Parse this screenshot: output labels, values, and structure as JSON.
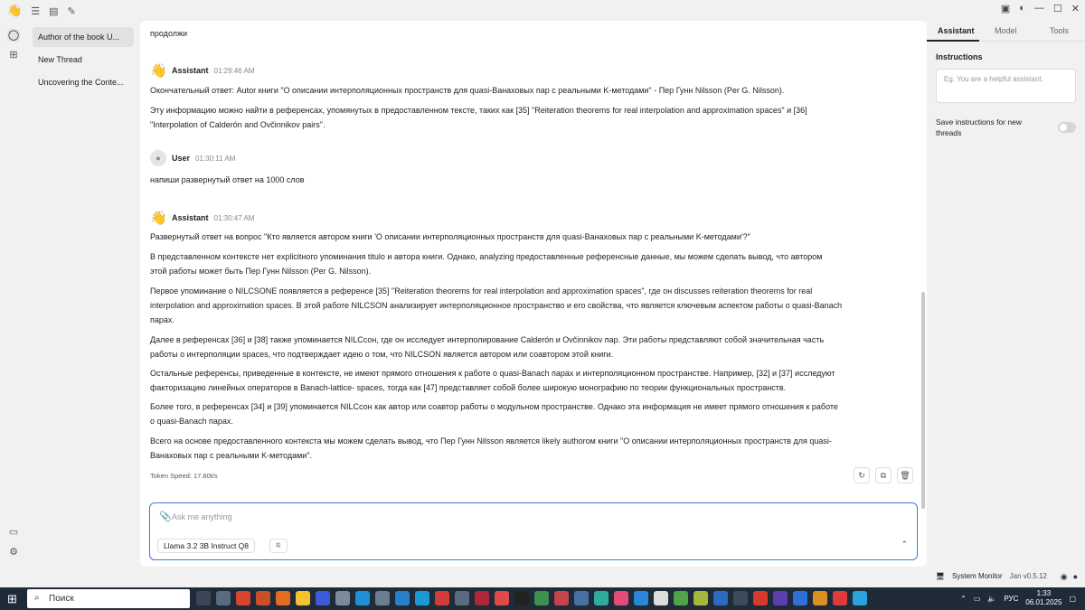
{
  "app": {
    "version": "Jan v0.5.12"
  },
  "threads": [
    {
      "title": "Author of the book U..."
    },
    {
      "title": "New Thread"
    },
    {
      "title": "Uncovering the Conte..."
    }
  ],
  "messages": {
    "prev_user_text": "продолжи",
    "assistant1": {
      "name": "Assistant",
      "time": "01:29:46 AM",
      "lines": [
        "Окончательный ответ: Autor книги \"О описании интерполяционных пространств для quasi-Ванаховых пар с реальными K-методами\" - Пер Гунн Nilsson (Per G. Nilsson).",
        "Эту информацию можно найти в референсах, упомянутых в предоставленном тексте, таких как [35] \"Reiteration theorems for real interpolation and approximation spaces\" и [36]",
        "\"Interpolation of Calderón and Ovčinnikov pairs\"."
      ]
    },
    "user": {
      "name": "User",
      "time": "01:30:11 AM",
      "text": "напиши развернутый ответ на 1000 слов"
    },
    "assistant2": {
      "name": "Assistant",
      "time": "01:30:47 AM",
      "lines": [
        "Развернутый ответ на вопрос \"Кто является автором книги 'О описании интерполяционных пространств для quasi-Ванаховых пар с реальными K-методами'?\"",
        "В представленном контексте нет explicitного упоминания titulo и автора книги. Однако, analyzing предоставленные референсные данные, мы можем сделать вывод, что автором",
        "этой работы может быть Пер Гунн Nilsson (Per G. Nilsson).",
        "Первое упоминание о NILCSONE появляется в референсе [35] \"Reiteration theorems for real interpolation and approximation spaces\", где он discusses reiteration theorems for real",
        "interpolation and approximation spaces. В этой работе NILCSON анализирует интерполяционное пространство и его свойства, что является ключевым аспектом работы о quasi-Banach",
        "парах.",
        "Далее в референсах [36] и [38] также упоминается NILCсон, где он исследует интерполирование Calderón и Ovčinnikov пар. Эти работы представляют собой значительная часть",
        "работы о интерполяции spaces, что подтверждает идею о том, что NILCSON является автором или соавтором этой книги.",
        "Остальные референсы, приведенные в контексте, не имеют прямого отношения к работе о quasi-Banach парах и интерполяционном пространстве. Например, [32] и [37] исследуют",
        "факторизацию линейных операторов в Banach-lattice- spaces, тогда как [47] представляет собой более широкую монографию по теории функциональных пространств.",
        "Более того, в референсах [34] и [39] упоминается NILCсон как автор или соавтор работы о модульном пространстве. Однако эта информация не имеет прямого отношения к работе",
        "о quasi-Banach парах.",
        "Всего на основе предоставленного контекста мы можем сделать вывод, что Пер Гунн Nilsson является likely authorом книги \"О описании интерполяционных пространств для quasi-",
        "Ванаховых пар с реальными K-методами\"."
      ],
      "token_speed": "Token Speed: 17.60t/s"
    }
  },
  "composer": {
    "placeholder": "Ask me anything",
    "model": "Llama 3.2 3B Instruct Q8"
  },
  "right_panel": {
    "tabs": [
      "Assistant",
      "Model",
      "Tools"
    ],
    "instructions_title": "Instructions",
    "instructions_placeholder": "Eg. You are a helpful assistant.",
    "save_label": "Save instructions for new threads",
    "save_toggle_on": false
  },
  "status_bar": {
    "system_monitor": "System Monitor"
  },
  "taskbar": {
    "search_label": "Поиск",
    "lang": "РУС",
    "time": "1:33",
    "date": "06.01.2025"
  }
}
